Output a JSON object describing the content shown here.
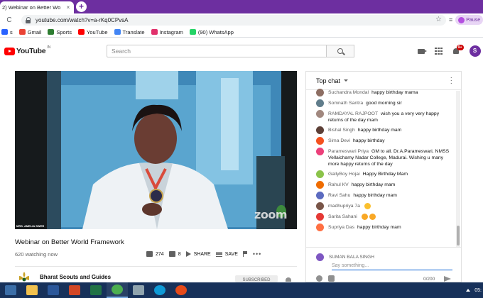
{
  "browser": {
    "tab_title": "2) Webinar on Better Wo",
    "tab_close": "×",
    "new_tab": "+",
    "back": "←",
    "forward": "→",
    "reload": "C",
    "url": "youtube.com/watch?v=a-rKq0CPvsA",
    "star": "☆",
    "profile_status": "Pause",
    "accent_color": "#6d2fa0"
  },
  "bookmarks": [
    {
      "label": "s",
      "color": "#2962ff"
    },
    {
      "label": "Gmail",
      "color": "#ea4335"
    },
    {
      "label": "Sports",
      "color": "#2e7d32"
    },
    {
      "label": "YouTube",
      "color": "#ff0000"
    },
    {
      "label": "Translate",
      "color": "#4285f4"
    },
    {
      "label": "Instagram",
      "color": "#e1306c"
    },
    {
      "label": "(90) WhatsApp",
      "color": "#25d366"
    }
  ],
  "youtube": {
    "logo_text": "YouTube",
    "logo_sup": "IN",
    "search_placeholder": "Search",
    "notification_count": "9+",
    "user_initial": "S"
  },
  "video": {
    "caption": "MRS. AMELIA SWER",
    "watermark": "zoom",
    "title": "Webinar on Better World Framework",
    "watching": "620 watching now",
    "likes": "274",
    "dislikes": "8",
    "share_label": "SHARE",
    "save_label": "SAVE",
    "more_label": "•••",
    "channel_name": "Bharat Scouts and Guides",
    "subscribe_label": "SUBSCRIBED"
  },
  "chat": {
    "header": "Top chat",
    "messages": [
      {
        "author": "Suchandra Mondal",
        "text": "happy birthday mama",
        "color": "#8d6e63"
      },
      {
        "author": "Somnath Santra",
        "text": "good morning sir",
        "color": "#607d8b"
      },
      {
        "author": "RAMDAYAL RAJPOOT",
        "text": "wish you a very very happy returns of the day mam",
        "color": "#a1887f"
      },
      {
        "author": "Bishal Singh",
        "text": "happy birthday mam",
        "color": "#5d4037"
      },
      {
        "author": "Sima Devi",
        "text": "happy birthday",
        "color": "#f4511e"
      },
      {
        "author": "Parameswari Priya",
        "text": "GM to all. Dr.A.Parameswari, NMSS Vellaichamy Nadar College, Madurai. Wishing u many more happy returns of the day",
        "color": "#ec407a"
      },
      {
        "author": "GallyBoy Hojai",
        "text": "Happy Birthday Mam",
        "color": "#8bc34a"
      },
      {
        "author": "Rahul KV",
        "text": "happy birthday mam",
        "color": "#ef6c00"
      },
      {
        "author": "Ravi Sahu",
        "text": "happy birthday mam",
        "color": "#5c6bc0"
      },
      {
        "author": "madhupriya 7a",
        "text": "",
        "emoji": true,
        "color": "#795548"
      },
      {
        "author": "Sarita Sahani",
        "text": "",
        "emoji2": true,
        "color": "#e53935"
      },
      {
        "author": "Supriya Das",
        "text": "happy birthday mam",
        "color": "#ff7043"
      }
    ],
    "input_user": "SUMAN BALA SINGH",
    "input_placeholder": "Say something...",
    "char_count": "0/200"
  },
  "taskbar": {
    "apps": [
      {
        "name": "start",
        "color": "#3b6ea8"
      },
      {
        "name": "file-explorer",
        "color": "#f2c14e"
      },
      {
        "name": "word",
        "color": "#2b579a"
      },
      {
        "name": "powerpoint",
        "color": "#d24726"
      },
      {
        "name": "excel",
        "color": "#217346"
      },
      {
        "name": "chrome",
        "color": "#4caf50"
      },
      {
        "name": "calculator",
        "color": "#90a4ae"
      },
      {
        "name": "edge",
        "color": "#0f9ad6"
      },
      {
        "name": "recorder",
        "color": "#e64a19"
      }
    ],
    "clock": "05:"
  }
}
